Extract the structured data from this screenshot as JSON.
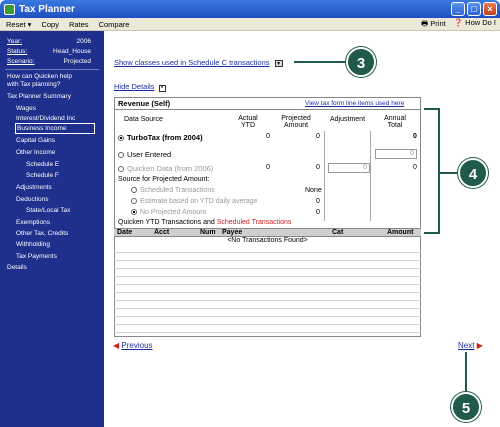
{
  "window": {
    "title": "Tax Planner"
  },
  "menubar": {
    "reset": "Reset ▾",
    "copy": "Copy",
    "rates": "Rates",
    "compare": "Compare",
    "print": "Print",
    "how_do_i": "How Do I"
  },
  "sidebar": {
    "year_label": "Year:",
    "year_value": "2006",
    "status_label": "Status:",
    "status_value": "Head_House",
    "scenario_label": "Scenario:",
    "scenario_value": "Projected",
    "help_line1": "How can Quicken help",
    "help_line2": "with Tax planning?",
    "summary": "Tax Planner Summary",
    "items": [
      {
        "label": "Wages"
      },
      {
        "label": "Interest/Dividend Inc"
      },
      {
        "label": "Business Income"
      },
      {
        "label": "Capital Gains"
      },
      {
        "label": "Other Income"
      },
      {
        "label": "Schedule E"
      },
      {
        "label": "Schedule F"
      },
      {
        "label": "Adjustments"
      },
      {
        "label": "Deductions"
      },
      {
        "label": "State/Local Tax"
      },
      {
        "label": "Exemptions"
      },
      {
        "label": "Other Tax, Credits"
      },
      {
        "label": "Withholding"
      },
      {
        "label": "Tax Payments"
      },
      {
        "label": "Details"
      }
    ]
  },
  "main": {
    "show_classes": "Show classes used in Schedule C transactions",
    "hide_details": "Hide Details",
    "panel_title": "Revenue (Self)",
    "view_link": "View tax form line items used here",
    "headers": {
      "source": "Data Source",
      "actual": "Actual YTD",
      "projected": "Projected Amount",
      "adjustment": "Adjustment",
      "annual": "Annual Total"
    },
    "rows": [
      {
        "label": "TurboTax (from 2004)",
        "actual": "0",
        "projected": "0",
        "annual": "0"
      },
      {
        "label": "User Entered",
        "input": "0"
      },
      {
        "label": "Quicken Data (from 2006)",
        "actual": "0",
        "projected": "0",
        "adj_input": "0",
        "annual": "0"
      }
    ],
    "source_for_projected": "Source for Projected Amount:",
    "options": [
      {
        "label": "Scheduled Transactions",
        "value": "None"
      },
      {
        "label": "Estimate based on YTD daily average",
        "value": "0"
      },
      {
        "label": "No Projected Amount",
        "value": "0"
      }
    ],
    "ytd_label": "Quicken YTD Transactions and",
    "scheduled_label": "Scheduled Transactions",
    "table_headers": {
      "date": "Date",
      "acct": "Acct",
      "num": "Num",
      "payee": "Payee",
      "cat": "Cat",
      "amount": "Amount"
    },
    "no_transactions": "<No Transactions Found>",
    "previous": "Previous",
    "next": "Next"
  },
  "callouts": {
    "c3": "3",
    "c4": "4",
    "c5": "5"
  },
  "colors": {
    "sidebar": "#1f2f8c",
    "callout": "#1f5a4a",
    "title_bar": "#2a5ed6"
  }
}
